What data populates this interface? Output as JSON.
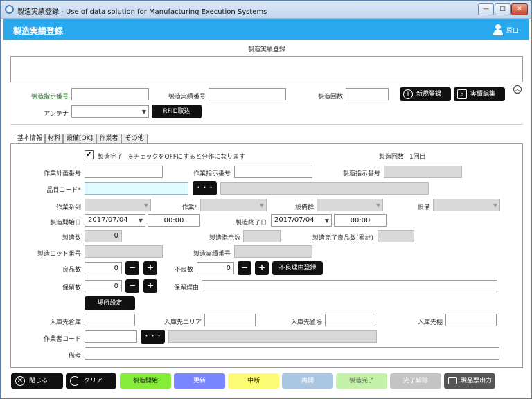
{
  "window": {
    "title": "製造実績登録 - Use of data solution for Manufacturing Execution Systems",
    "btn_min": "—",
    "btn_max": "□",
    "btn_close": "✕"
  },
  "header": {
    "title": "製造実績登録",
    "user_name": "原口"
  },
  "top": {
    "section_title": "製造実績登録",
    "order_no_label": "製造指示番号",
    "record_no_label": "製造実績番号",
    "run_count_label": "製造回数",
    "antenna_label": "アンテナ",
    "rfid_button": "RFID取込",
    "new_button": "新規登録",
    "edit_button": "実績編集",
    "collapse_icon": "︿"
  },
  "tabs": [
    "基本情報",
    "材料",
    "設備[OK]",
    "作業者",
    "その他"
  ],
  "basic": {
    "complete_label": "製造完了",
    "check_mark": "✔",
    "check_note": "※チェックをOFFにすると分作になります",
    "run_count_label": "製造回数",
    "run_count_value": "1回目",
    "plan_no_label": "作業計画番号",
    "work_order_label": "作業指示番号",
    "order_no_label": "製造指示番号",
    "item_code_label": "品目コード*",
    "dots": "・・・",
    "work_series_label": "作業系列",
    "work_label": "作業*",
    "equip_group_label": "設備群",
    "equip_label": "設備",
    "start_date_label": "製造開始日",
    "start_date": "2017/07/04",
    "start_time": "00:00",
    "end_date_label": "製造終了日",
    "end_date": "2017/07/04",
    "end_time": "00:00",
    "qty_label": "製造数",
    "qty_value": "0",
    "order_qty_label": "製造指示数",
    "done_good_label": "製造完了良品数(累計)",
    "lot_label": "製造ロット番号",
    "record_no_label": "製造実績番号",
    "good_label": "良品数",
    "good_value": "0",
    "bad_label": "不良数",
    "bad_value": "0",
    "bad_reason_button": "不良理由登録",
    "hold_label": "保留数",
    "hold_value": "0",
    "hold_reason_label": "保留理由",
    "minus": "−",
    "plus": "+",
    "location_button": "場所設定",
    "warehouse_label": "入庫先倉庫",
    "area_label": "入庫先エリア",
    "place_label": "入庫先置場",
    "shelf_label": "入庫先棚",
    "worker_code_label": "作業者コード",
    "remarks_label": "備考"
  },
  "footer": {
    "close": "閉じる",
    "clear": "クリア",
    "start": "製造開始",
    "update": "更新",
    "suspend": "中断",
    "resume": "再開",
    "complete": "製造完了",
    "cancel_complete": "完了解除",
    "print": "現品票出力"
  },
  "colors": {
    "header_bg": "#2aa8ee",
    "start_btn": "#86ec3a",
    "update_btn": "#7a86ff",
    "suspend_btn": "#fdfb74",
    "resume_btn": "#a9c6e3",
    "complete_btn": "#c3f1a8",
    "cancel_btn": "#c4c4c4"
  }
}
